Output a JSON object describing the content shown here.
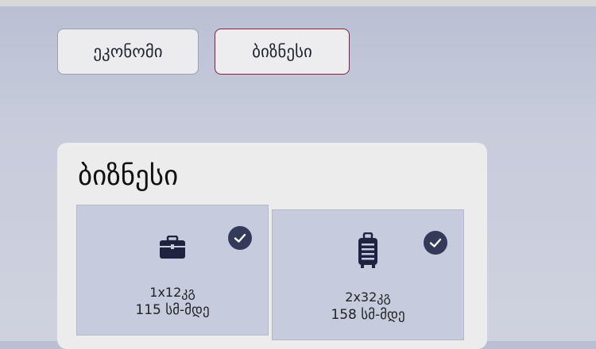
{
  "fare_tabs": [
    {
      "label": "ეკონომი",
      "selected": false
    },
    {
      "label": "ბიზნესი",
      "selected": true
    }
  ],
  "card": {
    "title": "ბიზნესი",
    "items": [
      {
        "icon": "briefcase-icon",
        "size": "1x12კგ",
        "dimension": "115 სმ-მდე",
        "checked": true
      },
      {
        "icon": "suitcase-icon",
        "size": "2x32კგ",
        "dimension": "158 სმ-მდე",
        "checked": true
      }
    ]
  },
  "colors": {
    "accent": "#8a1c3c",
    "check": "#333a5a",
    "tile": "#c7cbde"
  }
}
